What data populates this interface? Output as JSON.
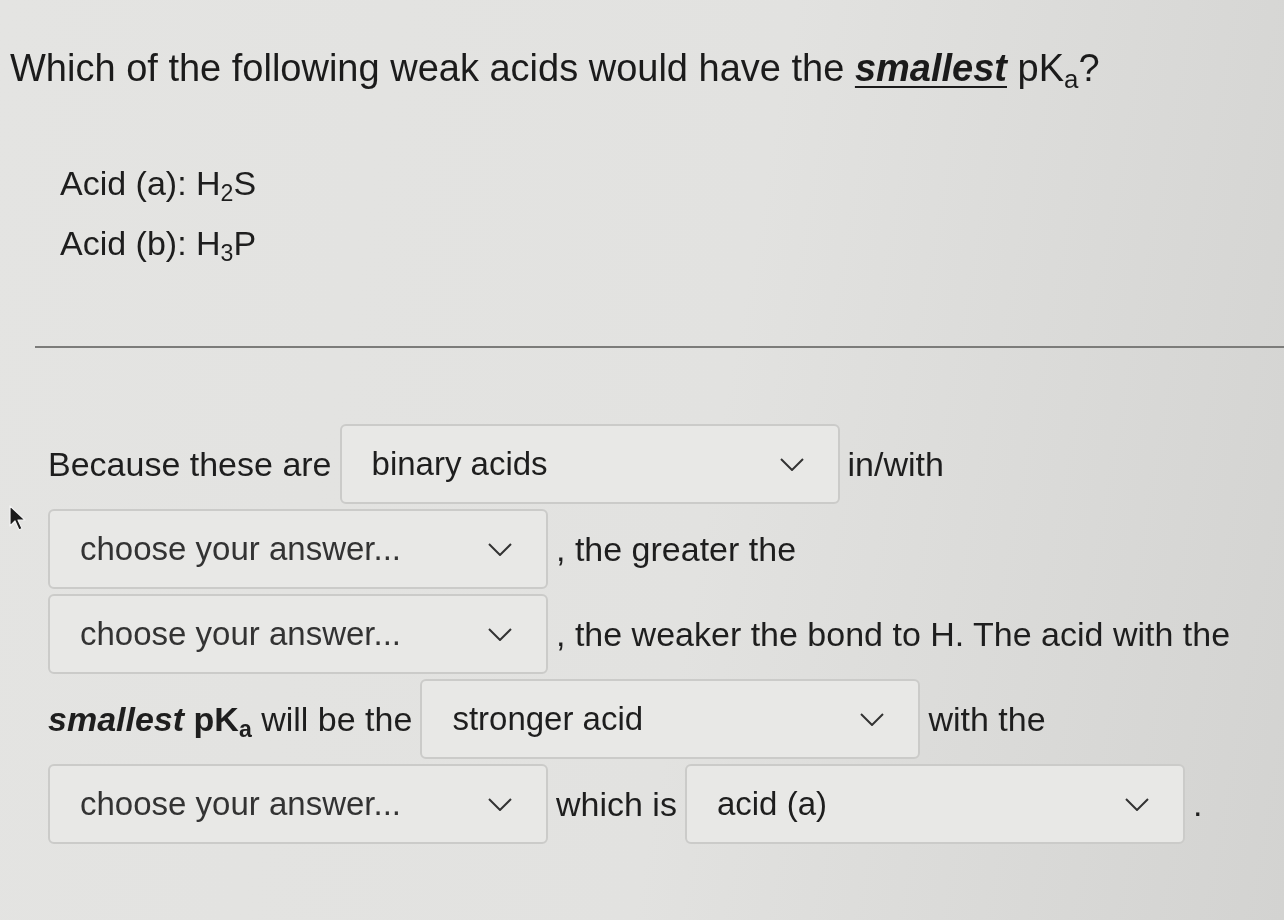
{
  "question": {
    "parts": [
      {
        "kind": "plain",
        "text": "Which of the following weak acids would have the "
      },
      {
        "kind": "emphasis",
        "text": "smallest"
      },
      {
        "kind": "plain",
        "text": " pK$_{a}$?"
      }
    ]
  },
  "acids": [
    "Acid (a): H$_{2}$S",
    "Acid (b): H$_{3}$P"
  ],
  "answer": {
    "lines": [
      {
        "parts": [
          {
            "kind": "text",
            "text": "Because these are"
          },
          {
            "kind": "dropdown",
            "value": "binary acids"
          },
          {
            "kind": "text",
            "text": "in/with"
          }
        ]
      },
      {
        "parts": [
          {
            "kind": "dropdown",
            "placeholder": "choose your answer..."
          },
          {
            "kind": "text",
            "text": ", the greater the"
          }
        ]
      },
      {
        "parts": [
          {
            "kind": "dropdown",
            "placeholder": "choose your answer..."
          },
          {
            "kind": "text",
            "text": ", the weaker the bond to H. The acid with the"
          }
        ]
      },
      {
        "parts": [
          {
            "kind": "text",
            "text": "*smallest* **pK$_{a}$** will be the"
          },
          {
            "kind": "dropdown",
            "value": "stronger acid"
          },
          {
            "kind": "text",
            "text": "with the"
          }
        ]
      },
      {
        "parts": [
          {
            "kind": "dropdown",
            "placeholder": "choose your answer..."
          },
          {
            "kind": "text",
            "text": "which is"
          },
          {
            "kind": "dropdown",
            "value": "acid (a)"
          },
          {
            "kind": "text",
            "text": "."
          }
        ]
      }
    ]
  }
}
